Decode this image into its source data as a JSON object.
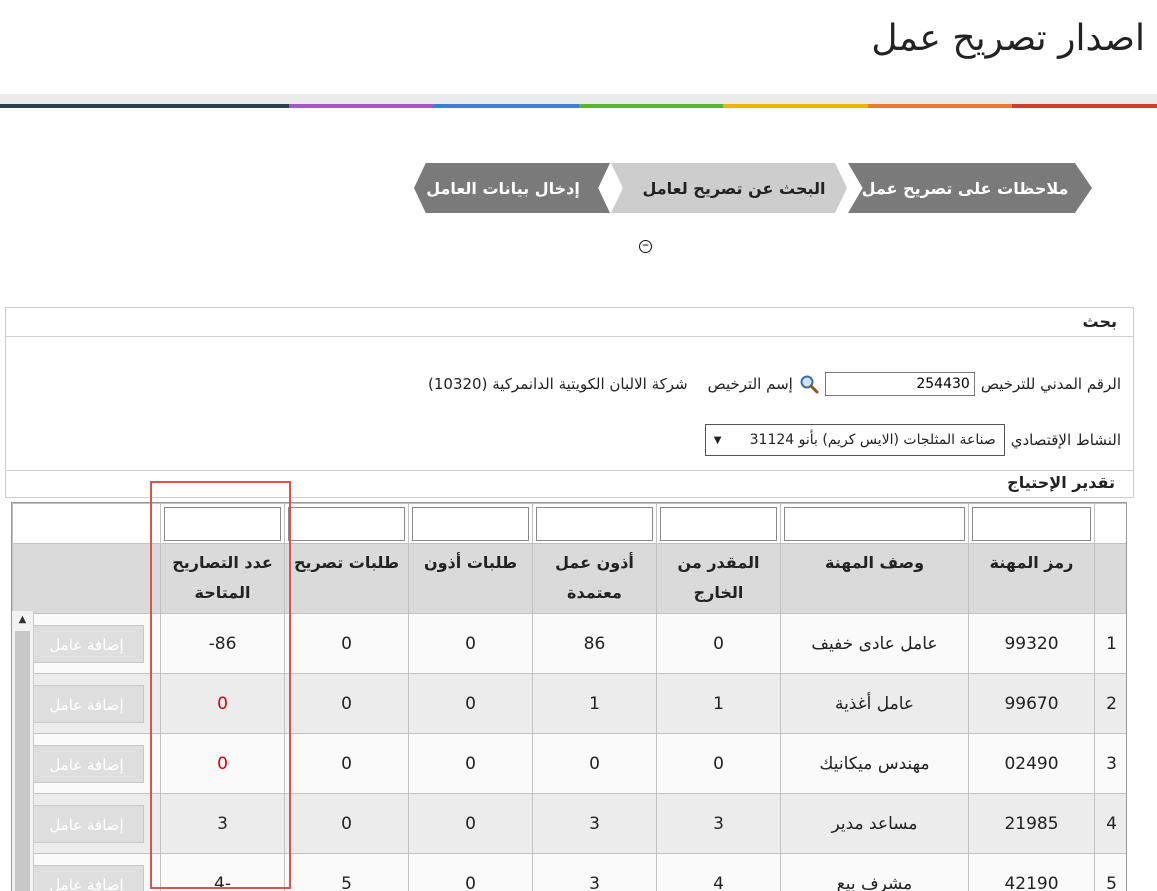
{
  "page": {
    "title": "اصدار تصريح عمل"
  },
  "colors": {
    "bar": [
      "#2f3e4c",
      "#2f3e4c",
      "#a557c9",
      "#3b7fd4",
      "#5cb531",
      "#f0b400",
      "#ee7a28",
      "#d63a2a"
    ]
  },
  "wizard": {
    "step_notes": "ملاحظات على تصريح عمل",
    "step_search": "البحث عن تصريح لعامل",
    "step_enter": "إدخال بيانات العامل"
  },
  "search": {
    "header": "بحث",
    "civil_label": "الرقم المدني للترخيص",
    "civil_value": "254430",
    "license_name_label": "إسم الترخيص",
    "company": "(10320) شركة الالبان الكويتية الدانمركية",
    "activity_label": "النشاط الإقتصادي",
    "activity_value": "31124 صناعة المثلجات (الايس كريم) بأنو"
  },
  "need": {
    "header": "تقدير الإحتياج",
    "columns": {
      "code": "رمز المهنة",
      "desc": "وصف المهنة",
      "estimated_l1": "المقدر من",
      "estimated_l2": "الخارج",
      "approved_l1": "أذون عمل",
      "approved_l2": "معتمدة",
      "perm_requests": "طلبات أذون",
      "permit_requests": "طلبات تصريح",
      "available_l1": "عدد التصاريح",
      "available_l2": "المتاحة"
    },
    "add_label": "إضافة عامل",
    "rows": [
      {
        "idx": "1",
        "code": "99320",
        "desc": "عامل عادى خفيف",
        "estimated": "0",
        "approved": "86",
        "perm_requests": "0",
        "permit_requests": "0",
        "available": "86-"
      },
      {
        "idx": "2",
        "code": "99670",
        "desc": "عامل أغذية",
        "estimated": "1",
        "approved": "1",
        "perm_requests": "0",
        "permit_requests": "0",
        "available": "0"
      },
      {
        "idx": "3",
        "code": "02490",
        "desc": "مهندس ميكانيك",
        "estimated": "0",
        "approved": "0",
        "perm_requests": "0",
        "permit_requests": "0",
        "available": "0"
      },
      {
        "idx": "4",
        "code": "21985",
        "desc": "مساعد مدير",
        "estimated": "3",
        "approved": "3",
        "perm_requests": "0",
        "permit_requests": "0",
        "available": "3"
      },
      {
        "idx": "5",
        "code": "42190",
        "desc": "مشرف بيع",
        "estimated": "4",
        "approved": "3",
        "perm_requests": "0",
        "permit_requests": "5",
        "available": "-4"
      }
    ]
  }
}
